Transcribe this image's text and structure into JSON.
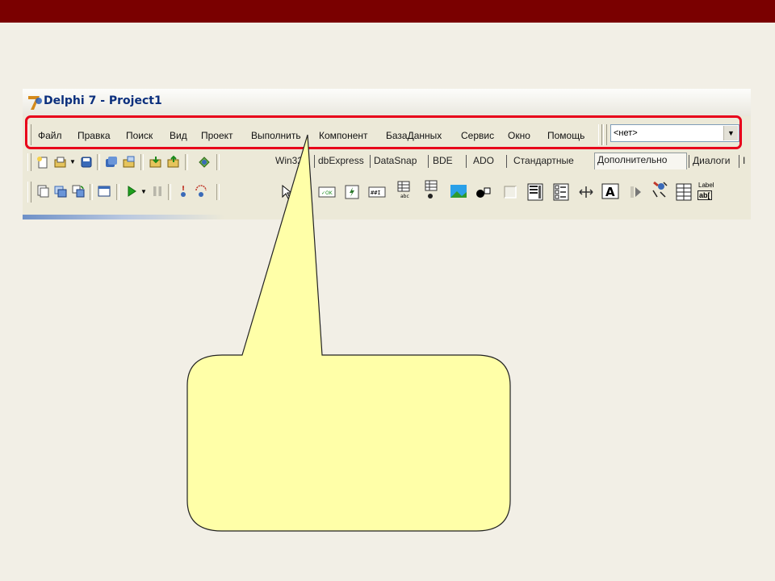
{
  "window": {
    "title": "Delphi 7 - Project1"
  },
  "menu": {
    "items": [
      "Файл",
      "Правка",
      "Поиск",
      "Вид",
      "Проект",
      "Выполнить",
      "Компонент",
      "БазаДанных",
      "Сервис",
      "Окно",
      "Помощь"
    ]
  },
  "combo": {
    "value": "<нет>"
  },
  "palette": {
    "tabs": [
      "Win32",
      "dbExpress",
      "DataSnap",
      "BDE",
      "ADO",
      "Стандартные",
      "Дополнительно",
      "Диалоги",
      "I"
    ],
    "active": "Дополнительно",
    "label_icon_text": "Label",
    "label_icon_text2": "ab["
  },
  "colors": {
    "header_bar": "#7a0000",
    "highlight": "#e8001a",
    "callout_fill": "#ffffa8",
    "title_text": "#0b2f7d"
  }
}
